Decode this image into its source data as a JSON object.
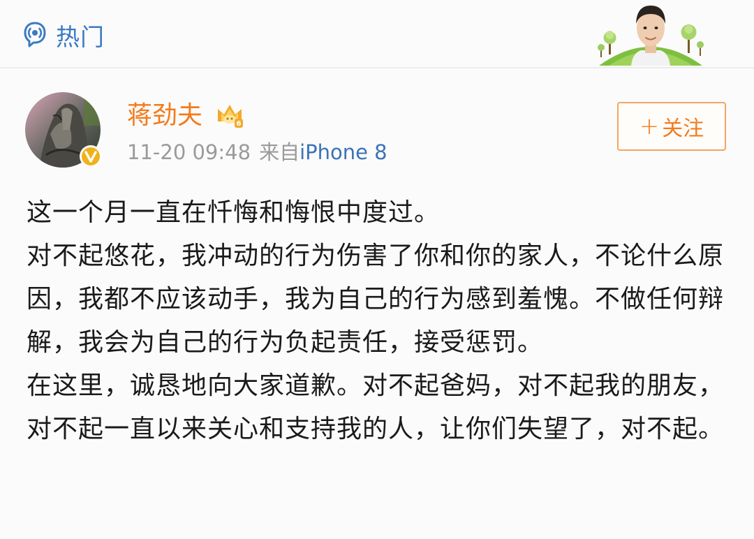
{
  "header": {
    "tab_label": "热门",
    "tab_icon": "hot-topic-icon",
    "banner_icon": "celebrity-banner-art"
  },
  "post": {
    "author": {
      "name": "蒋劲夫",
      "avatar_icon": "user-avatar",
      "verified_icon": "verified-v-icon",
      "member_badge_icon": "vip-crown-icon"
    },
    "time": "11-20 09:48",
    "from_label": "来自",
    "device": "iPhone 8",
    "follow_label": "关注",
    "follow_plus": "+",
    "paragraphs": [
      "这一个月一直在忏悔和悔恨中度过。",
      "对不起悠花，我冲动的行为伤害了你和你的家人，不论什么原因，我都不应该动手，我为自己的行为感到羞愧。不做任何辩解，我会为自己的行为负起责任，接受惩罚。",
      "在这里，诚恳地向大家道歉。对不起爸妈，对不起我的朋友，对不起一直以来关心和支持我的人，让你们失望了，对不起。"
    ]
  },
  "colors": {
    "link_blue": "#3a7ac4",
    "author_orange": "#f37b1c",
    "meta_gray": "#9a9a9a",
    "body_text": "#1a1a1a",
    "follow_border": "#f1a661"
  }
}
